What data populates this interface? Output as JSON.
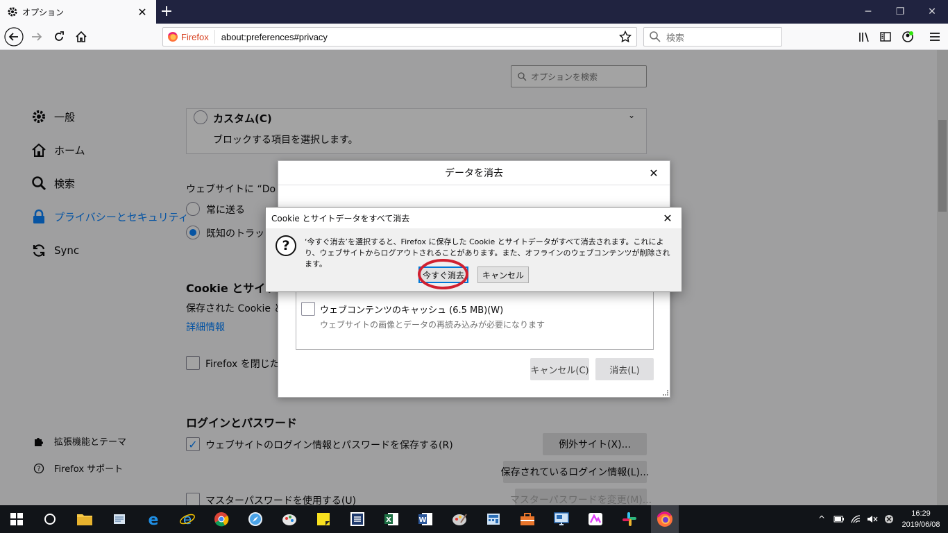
{
  "browser": {
    "tab_title": "オプション",
    "identity": "Firefox",
    "url": "about:preferences#privacy",
    "search_placeholder": "検索"
  },
  "prefs": {
    "search_placeholder": "オプションを検索",
    "categories": [
      {
        "label": "一般",
        "icon": "gear-icon"
      },
      {
        "label": "ホーム",
        "icon": "home-icon"
      },
      {
        "label": "検索",
        "icon": "search-icon"
      },
      {
        "label": "プライバシーとセキュリティ",
        "icon": "lock-icon",
        "active": true
      },
      {
        "label": "Sync",
        "icon": "sync-icon"
      }
    ],
    "footer_links": [
      {
        "label": "拡張機能とテーマ",
        "icon": "puzzle-icon"
      },
      {
        "label": "Firefox サポート",
        "icon": "help-icon"
      }
    ],
    "custom_option": "カスタム(C)",
    "custom_desc": "ブロックする項目を選択します。",
    "dnt_label": "ウェブサイトに “Do Not",
    "dnt_always": "常に送る",
    "dnt_known": "既知のトラッカ",
    "cookie_heading": "Cookie とサイトデ",
    "cookie_desc": "保存された Cookie と",
    "more_info": "詳細情報",
    "close_clear": "Firefox を閉じたと",
    "login_heading": "ログインとパスワード",
    "save_logins": "ウェブサイトのログイン情報とパスワードを保存する(R)",
    "exceptions_btn": "例外サイト(X)...",
    "saved_logins_btn": "保存されているログイン情報(L)...",
    "master_password": "マスターパスワードを使用する(U)",
    "change_master_btn": "マスターパスワードを変更(M)..."
  },
  "clear_dialog": {
    "title": "データを消去",
    "cache_label": "ウェブコンテンツのキャッシュ (6.5 MB)(W)",
    "cache_desc": "ウェブサイトの画像とデータの再読み込みが必要になります",
    "cancel": "キャンセル(C)",
    "clear": "消去(L)"
  },
  "confirm_dialog": {
    "title": "Cookie とサイトデータをすべて消去",
    "message": "‘今すぐ消去’を選択すると、Firefox に保存した Cookie とサイトデータがすべて消去されます。これにより、ウェブサイトからログアウトされることがあります。また、オフラインのウェブコンテンツが削除されます。",
    "confirm": "今すぐ消去",
    "cancel": "キャンセル"
  },
  "taskbar": {
    "time": "16:29",
    "date": "2019/06/08"
  },
  "colors": {
    "accent": "#0a84ff",
    "tab_strip": "#202340",
    "highlight_circle": "#d02030"
  }
}
